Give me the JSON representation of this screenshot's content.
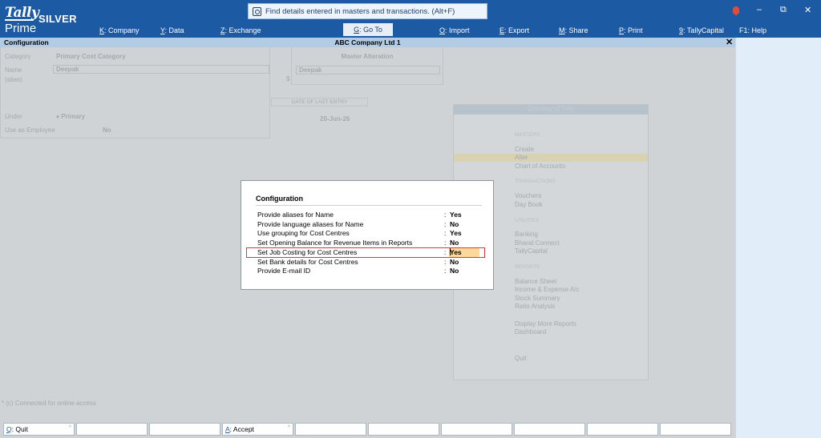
{
  "app": {
    "logo_brand": "Tally",
    "logo_edition": "SILVER",
    "logo_product": "Prime"
  },
  "search": {
    "placeholder": "Find details entered in masters and transactions. (Alt+F)"
  },
  "menu": [
    {
      "key": "K",
      "label": ": Company"
    },
    {
      "key": "Y",
      "label": ": Data"
    },
    {
      "key": "Z",
      "label": ": Exchange"
    },
    {
      "key": "G",
      "label": ": Go To"
    },
    {
      "key": "O",
      "label": ": Import"
    },
    {
      "key": "E",
      "label": ": Export"
    },
    {
      "key": "M",
      "label": ": Share"
    },
    {
      "key": "P",
      "label": ": Print"
    },
    {
      "key": "9",
      "label": ": TallyCapital"
    },
    {
      "key": "F1",
      "label": ": Help"
    }
  ],
  "window_controls": {
    "minimize": "–",
    "restore": "⧉",
    "close": "✕"
  },
  "titlebar": {
    "screen_title": "Configuration",
    "company": "ABC Company Ltd 1",
    "close": "✕"
  },
  "background": {
    "category_label": "Category",
    "category_value": "Primary Cost Category",
    "name_label": "Name",
    "name_value": "Deepak",
    "alias_label": "(alias)",
    "under_label": "Under",
    "under_value": "♦ Primary",
    "employee_label": "Use as Employee",
    "employee_value": "No",
    "master_title": "Master Alteration",
    "master_name": "Deepak",
    "master_side_mark": "$",
    "last_entry_label": "DATE OF LAST ENTRY",
    "last_entry_value": "20-Jun-26",
    "gateway_title": "Gateway of Tally",
    "gateway_groups": [
      {
        "heading": "MASTERS",
        "items": [
          "Create",
          "Alter",
          "Chart of Accounts"
        ]
      },
      {
        "heading": "TRANSACTIONS",
        "items": [
          "Vouchers",
          "Day Book"
        ]
      },
      {
        "heading": "UTILITIES",
        "items": [
          "Banking",
          "Bharat Connect",
          "TallyCapital"
        ]
      },
      {
        "heading": "REPORTS",
        "items": [
          "Balance Sheet",
          "Income & Expense A/c",
          "Stock Summary",
          "Ratio Analysis"
        ]
      },
      {
        "heading": "",
        "items": [
          "Display More Reports",
          "Dashboard"
        ]
      },
      {
        "heading": "",
        "items": [
          "Quit"
        ]
      }
    ],
    "connected_note": "* (c) Connected for online access"
  },
  "dialog": {
    "title": "Configuration",
    "options": [
      {
        "label": "Provide aliases for Name",
        "value": "Yes"
      },
      {
        "label": "Provide language aliases for Name",
        "value": "No"
      },
      {
        "label": "Use grouping for Cost Centres",
        "value": "Yes"
      },
      {
        "label": "Set Opening Balance for Revenue Items in Reports",
        "value": "No"
      },
      {
        "label": "Set Job Costing for Cost Centres",
        "value": "Yes"
      },
      {
        "label": "Set Bank details for Cost Centres",
        "value": "No"
      },
      {
        "label": "Provide E-mail ID",
        "value": "No"
      }
    ],
    "selected_index": 4
  },
  "bottom_buttons": [
    {
      "key": "Q",
      "label": ": Quit"
    },
    {
      "key": "",
      "label": ""
    },
    {
      "key": "",
      "label": ""
    },
    {
      "key": "A",
      "label": ": Accept"
    },
    {
      "key": "",
      "label": ""
    },
    {
      "key": "",
      "label": ""
    },
    {
      "key": "",
      "label": ""
    },
    {
      "key": "",
      "label": ""
    },
    {
      "key": "",
      "label": ""
    },
    {
      "key": "",
      "label": ""
    }
  ],
  "colors": {
    "topbar": "#1c5aa4",
    "selection_border": "#d23c3c",
    "selection_fill": "#fbd99a",
    "alert_bell": "#e24b3a"
  }
}
